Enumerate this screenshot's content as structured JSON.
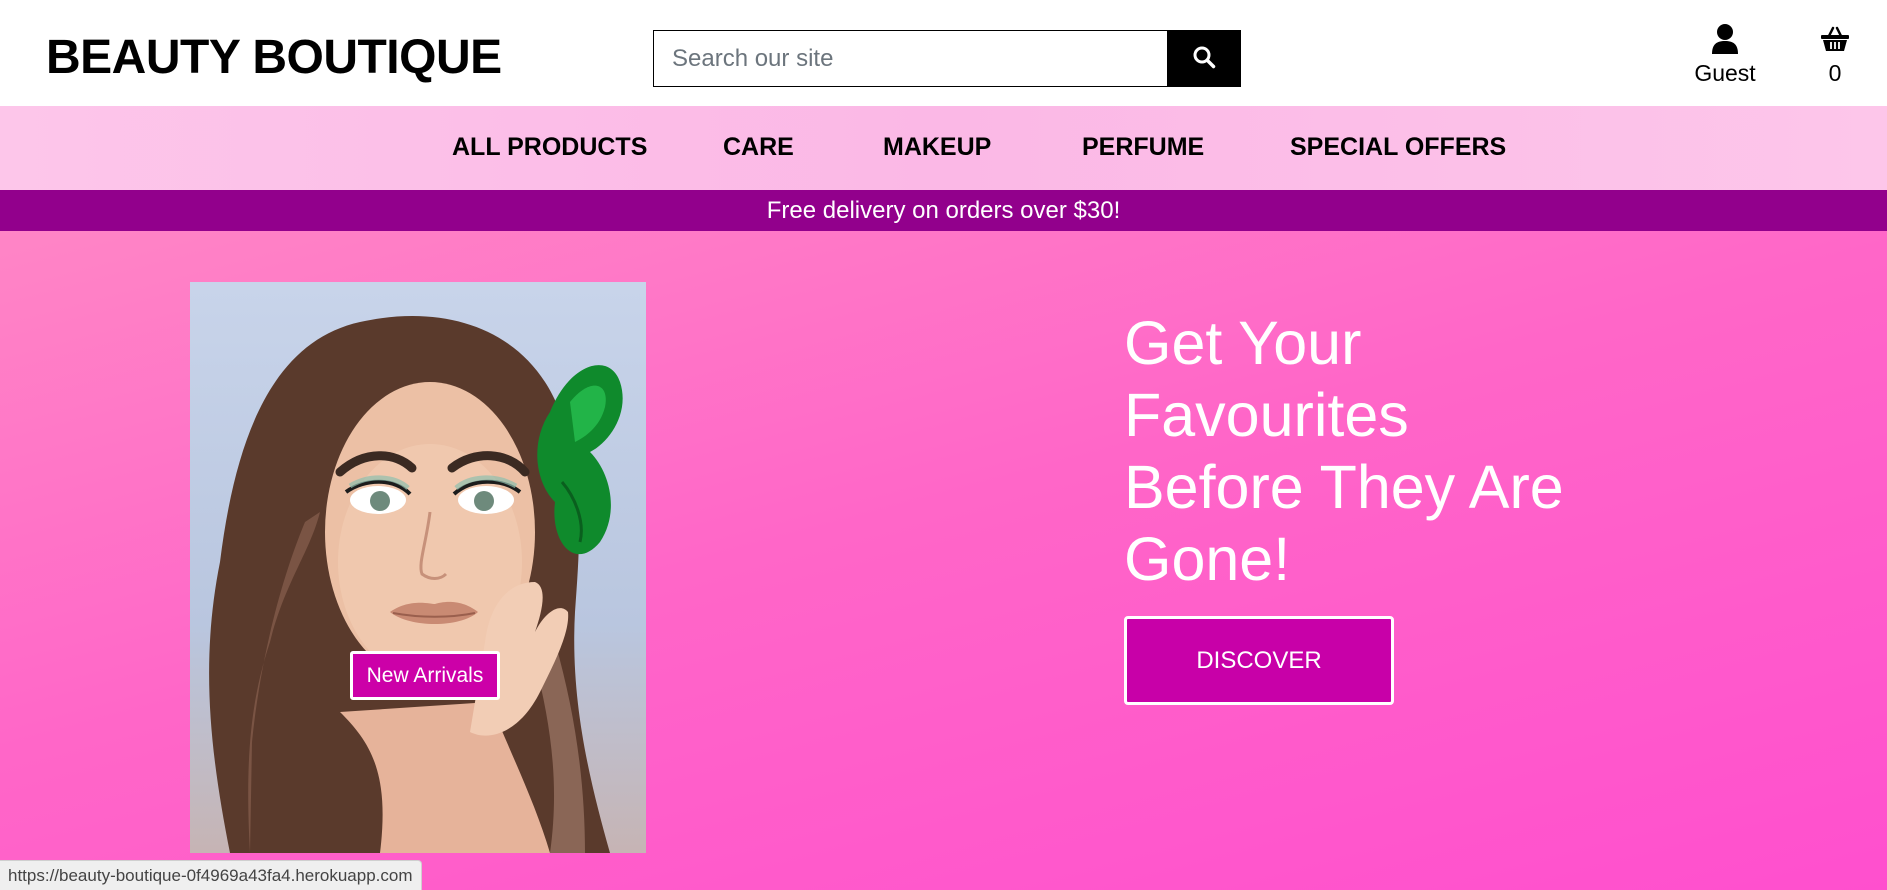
{
  "header": {
    "brand": "BEAUTY BOUTIQUE",
    "search": {
      "placeholder": "Search our site",
      "value": "",
      "button_icon": "search-icon"
    },
    "account": {
      "icon": "user-icon",
      "label": "Guest"
    },
    "cart": {
      "icon": "basket-icon",
      "count": "0"
    }
  },
  "nav": {
    "items": [
      {
        "label": "ALL PRODUCTS"
      },
      {
        "label": "CARE"
      },
      {
        "label": "MAKEUP"
      },
      {
        "label": "PERFUME"
      },
      {
        "label": "SPECIAL OFFERS"
      }
    ]
  },
  "banner": {
    "text": "Free delivery on orders over $30!"
  },
  "hero": {
    "line1": "Get Your",
    "line2": "Favourites",
    "line3": "Before They Are",
    "line4": "Gone!",
    "cta": "DISCOVER",
    "image_badge": "New Arrivals"
  },
  "status": {
    "url": "https://beauty-boutique-0f4969a43fa4.herokuapp.com"
  },
  "colors": {
    "brand_text": "#000000",
    "nav_background": "#fbb8e6",
    "banner_background": "#92008c",
    "hero_gradient_start": "#ff85c6",
    "hero_gradient_end": "#ff4fce",
    "cta_background": "#c800a8",
    "badge_background": "#cc00a8"
  }
}
